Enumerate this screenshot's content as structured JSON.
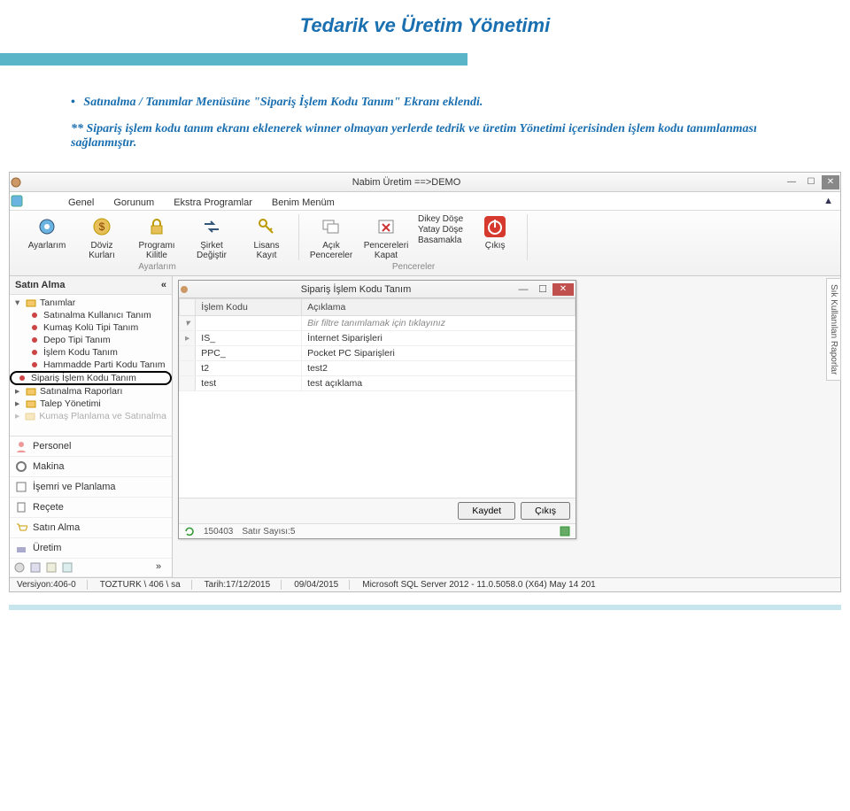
{
  "doc": {
    "title": "Tedarik ve Üretim Yönetimi",
    "bullet_line": "Satınalma / Tanımlar Menüsüne \"Sipariş İşlem Kodu Tanım\" Ekranı eklendi.",
    "detail_line": "** Sipariş işlem kodu tanım ekranı eklenerek winner olmayan yerlerde tedrik ve üretim Yönetimi içerisinden işlem kodu tanımlanması sağlanmıştır."
  },
  "app": {
    "title": "Nabim Üretim  ==>DEMO",
    "ribbon_tabs": [
      "Genel",
      "Gorunum",
      "Ekstra Programlar",
      "Benim Menüm"
    ],
    "ribbon_minimize": "▲",
    "groups": {
      "ayarlarim": {
        "caption": "Ayarlarım",
        "items": [
          {
            "label": "Ayarlarım",
            "icon": "gear-blue"
          },
          {
            "label": "Döviz Kurları",
            "icon": "currency"
          },
          {
            "label": "Programı Kilitle",
            "icon": "lock"
          },
          {
            "label": "Şirket Değiştir",
            "icon": "swap"
          },
          {
            "label": "Lisans Kayıt",
            "icon": "key"
          }
        ]
      },
      "pencereler": {
        "caption": "Pencereler",
        "open_label": "Açık Pencereler",
        "close_label": "Pencereleri Kapat",
        "stack": [
          "Dikey Döşe",
          "Yatay Döşe",
          "Basamakla"
        ]
      },
      "exit": {
        "label": "Çıkış"
      }
    },
    "sidebar": {
      "header": "Satın Alma",
      "collapse": "«",
      "items": [
        {
          "label": "Tanımlar",
          "type": "parent"
        },
        {
          "label": "Satınalma Kullanıcı Tanım",
          "type": "child"
        },
        {
          "label": "Kumaş Kolü Tipi Tanım",
          "type": "child"
        },
        {
          "label": "Depo Tipi Tanım",
          "type": "child"
        },
        {
          "label": "İşlem Kodu Tanım",
          "type": "child"
        },
        {
          "label": "Hammadde Parti Kodu Tanım",
          "type": "child"
        },
        {
          "label": "Sipariş İşlem Kodu Tanım",
          "type": "child",
          "highlight": true
        },
        {
          "label": "Satınalma Raporları",
          "type": "parent"
        },
        {
          "label": "Talep Yönetimi",
          "type": "parent"
        },
        {
          "label": "Kumaş Planlama ve Satınalma",
          "type": "parent-faded"
        }
      ],
      "nav": [
        {
          "label": "Personel",
          "icon": "person"
        },
        {
          "label": "Makina",
          "icon": "cog"
        },
        {
          "label": "İşemri ve Planlama",
          "icon": "plan"
        },
        {
          "label": "Reçete",
          "icon": "recipe"
        },
        {
          "label": "Satın Alma",
          "icon": "cart"
        },
        {
          "label": "Üretim",
          "icon": "factory"
        }
      ]
    },
    "child": {
      "title": "Sipariş İşlem Kodu Tanım",
      "columns": [
        "İşlem Kodu",
        "Açıklama"
      ],
      "filter_hint": "Bir filtre tanımlamak için tıklayınız",
      "rows": [
        {
          "code": "IS_",
          "desc": "İnternet Siparişleri"
        },
        {
          "code": "PPC_",
          "desc": "Pocket PC Siparişleri"
        },
        {
          "code": "t2",
          "desc": "test2"
        },
        {
          "code": "test",
          "desc": "test açıklama"
        }
      ],
      "btn_save": "Kaydet",
      "btn_close": "Çıkış",
      "status_date": "150403",
      "status_count": "Satır Sayısı:5"
    },
    "vtab": "Sık Kullanılan Raporlar",
    "status": {
      "version": "Versiyon:406-0",
      "user": "TOZTURK \\ 406 \\ sa",
      "date": "Tarih:17/12/2015",
      "date2": "09/04/2015",
      "sql": "Microsoft SQL Server 2012 - 11.0.5058.0 (X64) May 14 201"
    }
  }
}
